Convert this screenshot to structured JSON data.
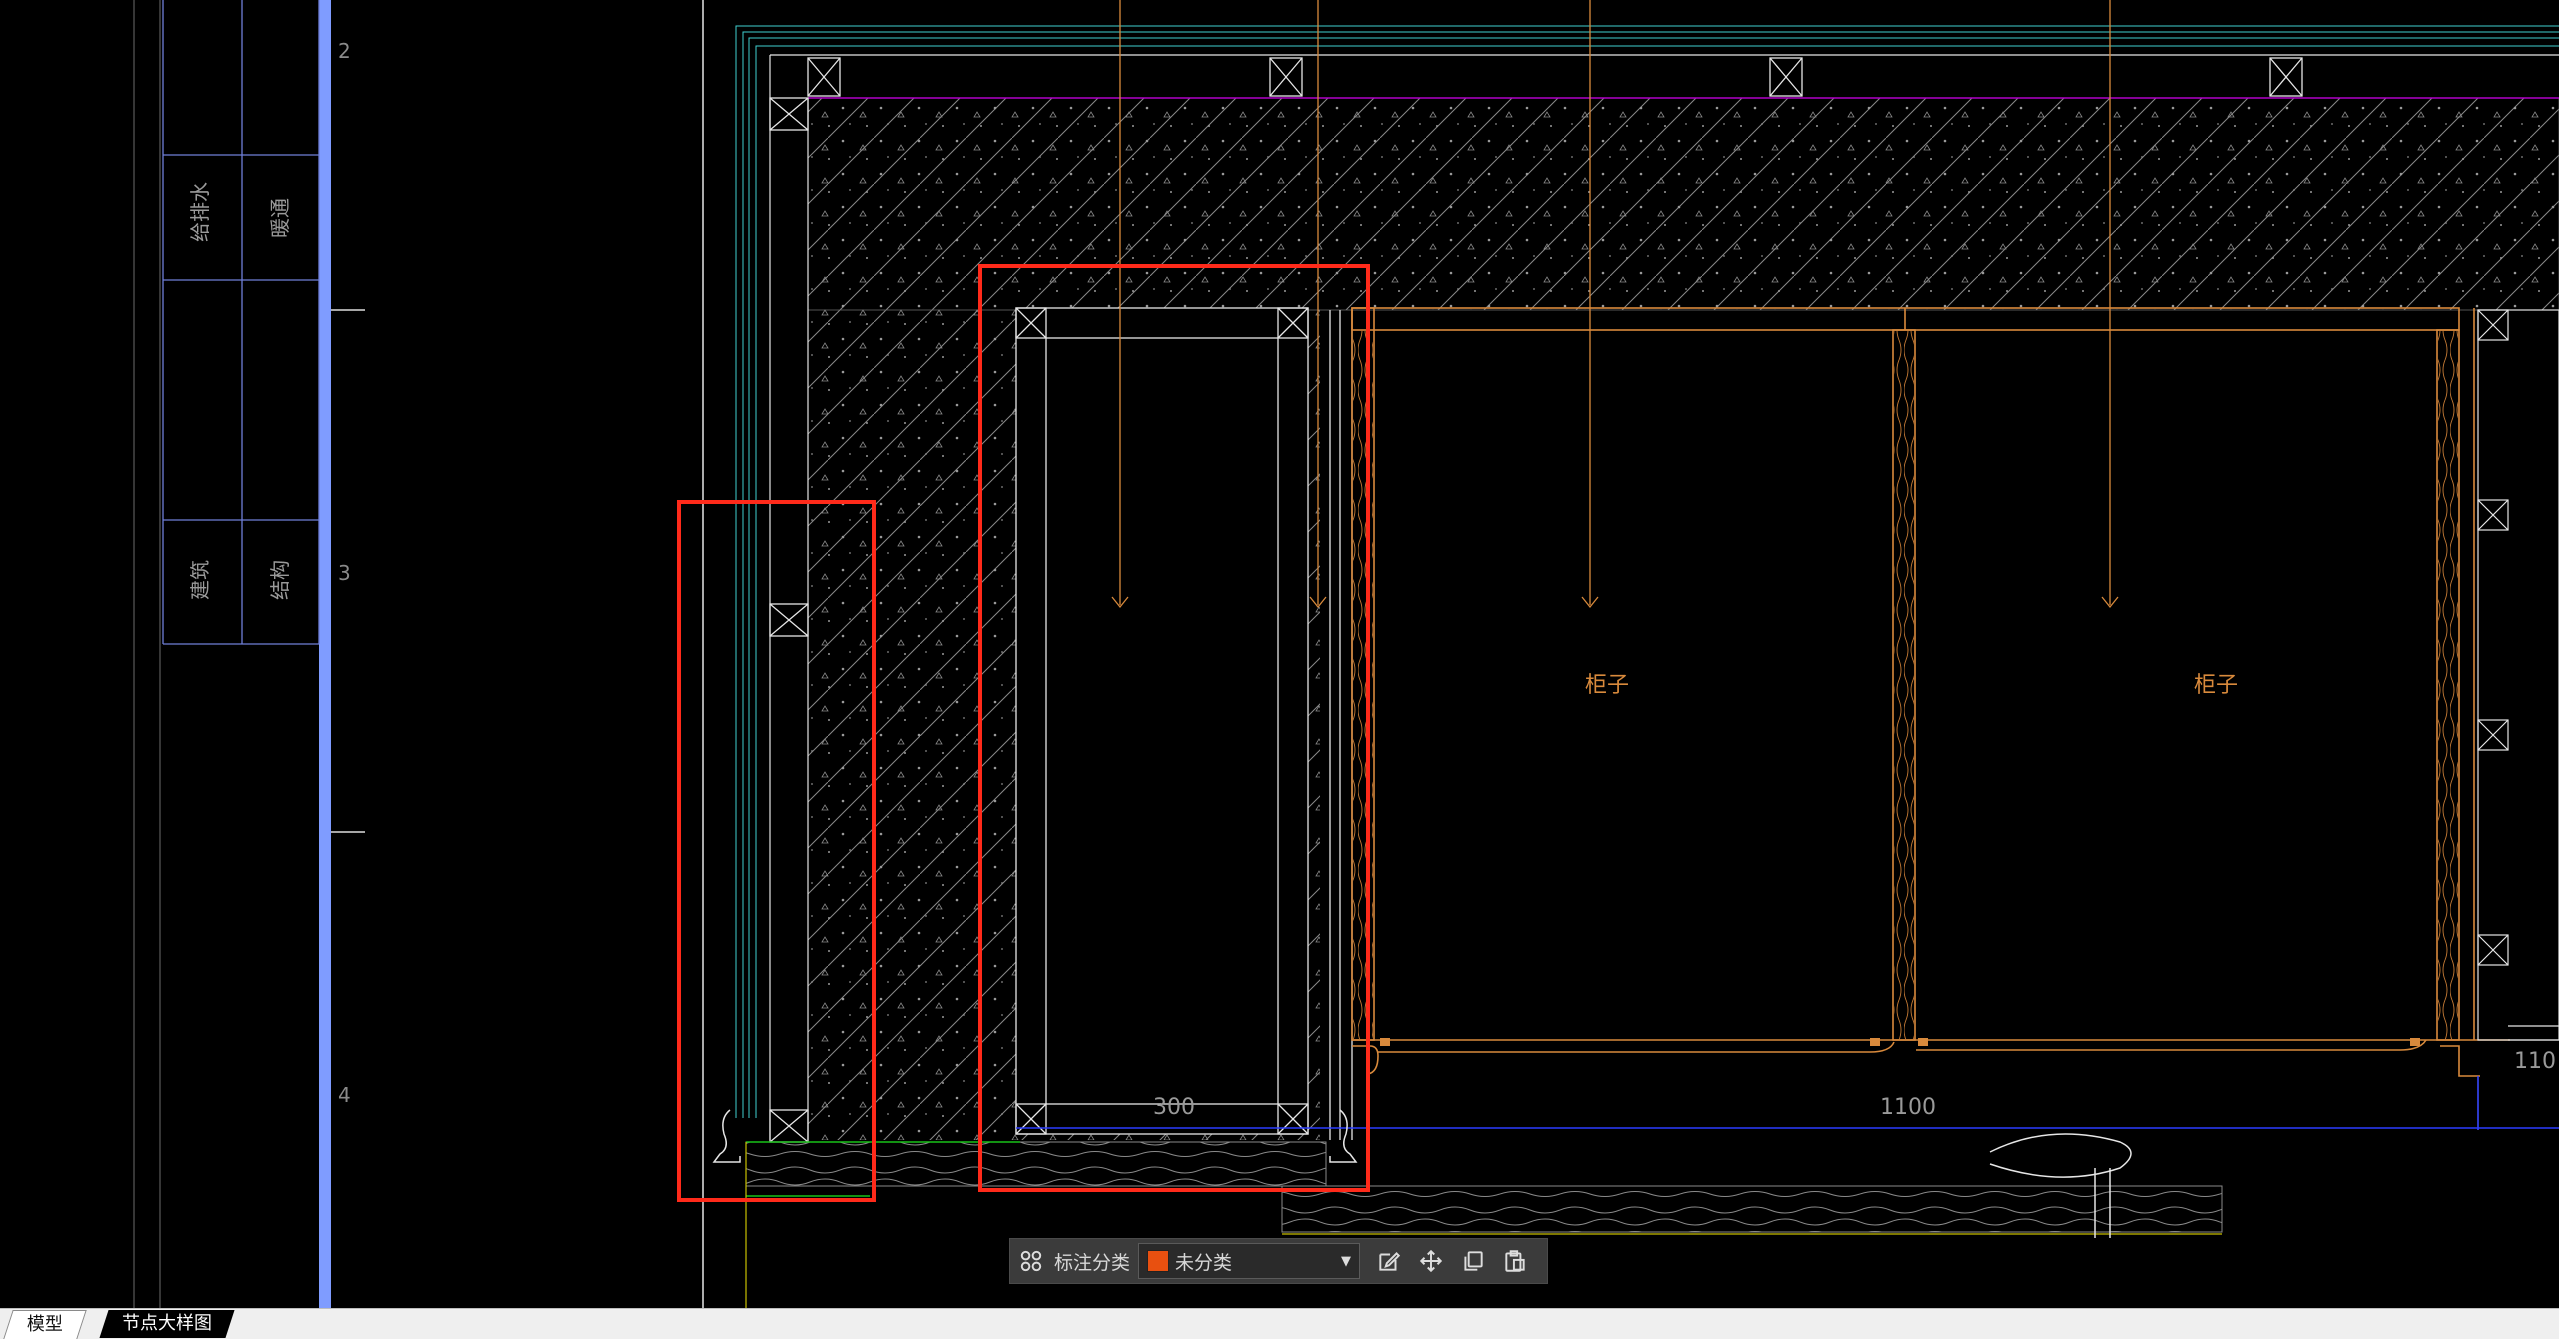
{
  "drawing": {
    "ruler_marks": [
      "2",
      "3",
      "4"
    ],
    "title_block": {
      "cell1": "给排水",
      "cell2": "暖通",
      "cell3": "建筑",
      "cell4": "结构"
    },
    "room_labels": [
      "柜子",
      "柜子"
    ],
    "dimensions": [
      "300",
      "1100",
      "110"
    ],
    "colors": {
      "highlight_box": "#ff2a1a",
      "ruler_bar": "#7f9cff",
      "cabinet": "#d98a3c",
      "wall": "#3fd0d0",
      "magenta_line": "#b000c8",
      "dimension_line": "#2a3cff",
      "floor_line": "#19c219",
      "white_line": "#e6e6e6"
    }
  },
  "toolbar": {
    "grid_icon": "grid-icon",
    "label": "标注分类",
    "select_value": "未分类",
    "select_color": "#e85010",
    "edit_icon": "edit-icon",
    "move_icon": "move-icon",
    "copy_icon": "copy-icon",
    "paste_icon": "paste-icon"
  },
  "tabs": {
    "model": "模型",
    "detail": "节点大样图"
  }
}
